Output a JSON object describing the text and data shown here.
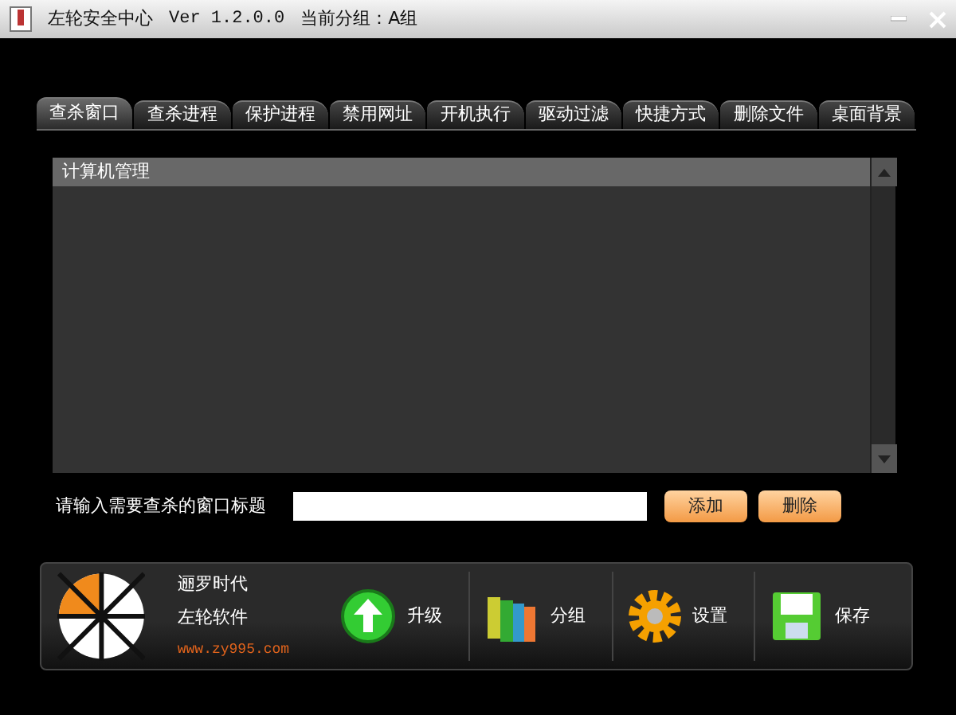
{
  "window": {
    "title": "左轮安全中心",
    "version": "Ver 1.2.0.0",
    "group": "当前分组：A组"
  },
  "tabs": [
    {
      "label": "查杀窗口",
      "selected": true
    },
    {
      "label": "查杀进程",
      "selected": false
    },
    {
      "label": "保护进程",
      "selected": false
    },
    {
      "label": "禁用网址",
      "selected": false
    },
    {
      "label": "开机执行",
      "selected": false
    },
    {
      "label": "驱动过滤",
      "selected": false
    },
    {
      "label": "快捷方式",
      "selected": false
    },
    {
      "label": "删除文件",
      "selected": false
    },
    {
      "label": "桌面背景",
      "selected": false
    }
  ],
  "list": {
    "items": [
      {
        "label": "计算机管理",
        "selected": true
      }
    ]
  },
  "input_row": {
    "label": "请输入需要查杀的窗口标题",
    "buttons": [
      "添加",
      "删除"
    ]
  },
  "footer": {
    "brand_lines": [
      "逦罗时代",
      "左轮软件"
    ],
    "url": "www.zy995.com",
    "tools": [
      {
        "kind": "upgrade",
        "label": "升级"
      },
      {
        "kind": "group",
        "label": "分组"
      },
      {
        "kind": "settings",
        "label": "设置"
      },
      {
        "kind": "save",
        "label": "保存"
      }
    ]
  }
}
